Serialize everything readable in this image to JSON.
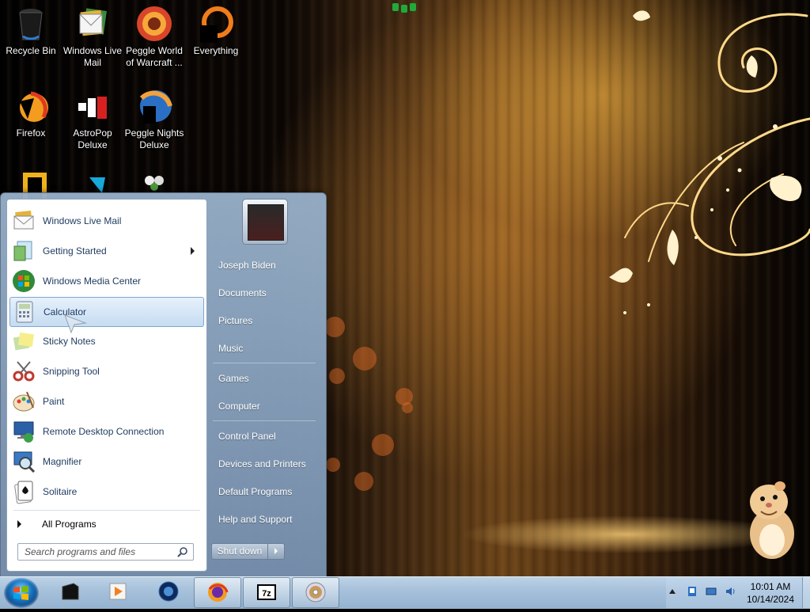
{
  "desktop": {
    "icons": [
      {
        "label": "Recycle Bin",
        "icon": "recycle-bin-icon"
      },
      {
        "label": "Windows Live Mail",
        "icon": "windows-live-mail-icon"
      },
      {
        "label": "Peggle World of Warcraft ...",
        "icon": "peggle-wow-icon"
      },
      {
        "label": "Everything",
        "icon": "everything-icon"
      },
      {
        "label": "Firefox",
        "icon": "firefox-icon"
      },
      {
        "label": "AstroPop Deluxe",
        "icon": "astropop-icon"
      },
      {
        "label": "Peggle Nights Deluxe",
        "icon": "peggle-nights-icon"
      }
    ]
  },
  "start_menu": {
    "programs": [
      {
        "label": "Windows Live Mail",
        "icon": "windows-live-mail-icon"
      },
      {
        "label": "Getting Started",
        "icon": "getting-started-icon",
        "has_submenu": true
      },
      {
        "label": "Windows Media Center",
        "icon": "windows-media-center-icon"
      },
      {
        "label": "Calculator",
        "icon": "calculator-icon",
        "highlighted": true
      },
      {
        "label": "Sticky Notes",
        "icon": "sticky-notes-icon"
      },
      {
        "label": "Snipping Tool",
        "icon": "snipping-tool-icon"
      },
      {
        "label": "Paint",
        "icon": "paint-icon"
      },
      {
        "label": "Remote Desktop Connection",
        "icon": "remote-desktop-icon"
      },
      {
        "label": "Magnifier",
        "icon": "magnifier-icon"
      },
      {
        "label": "Solitaire",
        "icon": "solitaire-icon"
      }
    ],
    "all_programs": "All Programs",
    "search_placeholder": "Search programs and files",
    "right_items": [
      "Joseph Biden",
      "Documents",
      "Pictures",
      "Music",
      "Games",
      "Computer",
      "Control Panel",
      "Devices and Printers",
      "Default Programs",
      "Help and Support"
    ],
    "shutdown_label": "Shut down"
  },
  "taskbar": {
    "pinned": [
      {
        "icon": "media-box-icon",
        "active": false
      },
      {
        "icon": "media-player-icon",
        "active": false
      },
      {
        "icon": "globe-icon",
        "active": false
      },
      {
        "icon": "firefox-icon",
        "active": true
      },
      {
        "icon": "7zip-icon",
        "active": true,
        "text": "7z"
      },
      {
        "icon": "disc-burner-icon",
        "active": true
      }
    ],
    "clock": {
      "time": "10:01 AM",
      "date": "10/14/2024"
    }
  },
  "colors": {
    "program_text": "#1e3a5f",
    "highlight": "#c6dcf2",
    "taskbar": "#a5c0da"
  }
}
